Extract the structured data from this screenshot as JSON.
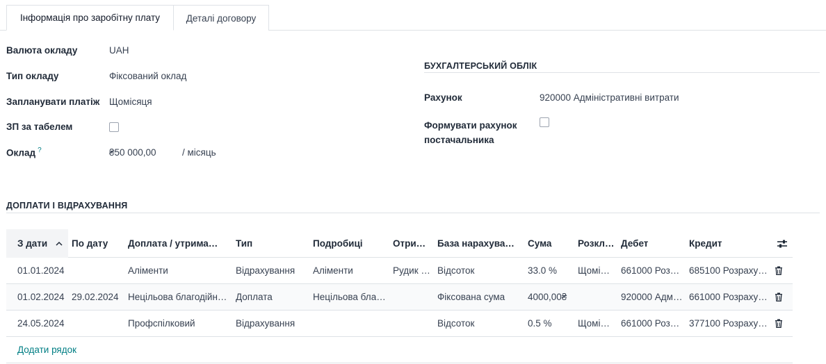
{
  "tabs": [
    {
      "label": "Інформація про заробітну плату",
      "active": true
    },
    {
      "label": "Деталі договору",
      "active": false
    }
  ],
  "salary": {
    "currency_label": "Валюта окладу",
    "currency_value": "UAH",
    "type_label": "Тип окладу",
    "type_value": "Фіксований оклад",
    "schedule_label": "Запланувати платіж",
    "schedule_value": "Щомісяця",
    "timesheet_label": "ЗП за табелем",
    "timesheet_checked": false,
    "wage_label": "Оклад",
    "wage_help": "?",
    "wage_value": "₴50 000,00",
    "wage_period": "/ місяць"
  },
  "accounting": {
    "title": "БУХГАЛТЕРСЬКИЙ ОБЛІК",
    "account_label": "Рахунок",
    "account_value": "920000 Адміністративні витрати",
    "vendor_bill_label_1": "Формувати рахунок",
    "vendor_bill_label_2": "постачальника",
    "vendor_bill_checked": false
  },
  "allowances": {
    "title": "ДОПЛАТИ І ВІДРАХУВАННЯ",
    "columns": {
      "date_from": "З дати",
      "date_to": "По дату",
      "allowance": "Доплата / утрима…",
      "type": "Тип",
      "details": "Подробиці",
      "recipient": "Отри…",
      "base": "База нарахува…",
      "amount": "Сума",
      "distribution": "Розкл…",
      "debit": "Дебет",
      "credit": "Кредит"
    },
    "rows": [
      {
        "date_from": "01.01.2024",
        "date_to": "",
        "allowance": "Аліменти",
        "type": "Відрахування",
        "details": "Аліменти",
        "recipient": "Рудик …",
        "base": "Відсоток",
        "amount": "33.0 %",
        "distribution": "Щомі…",
        "debit": "661000 Роз…",
        "credit": "685100 Розраху…"
      },
      {
        "date_from": "01.02.2024",
        "date_to": "29.02.2024",
        "allowance": "Нецільова благодійн…",
        "type": "Доплата",
        "details": "Нецільова бла…",
        "recipient": "",
        "base": "Фіксована сума",
        "amount": "4000,00₴",
        "distribution": "",
        "debit": "920000 Адм…",
        "credit": "661000 Розраху…"
      },
      {
        "date_from": "24.05.2024",
        "date_to": "",
        "allowance": "Профспілковий",
        "type": "Відрахування",
        "details": "",
        "recipient": "",
        "base": "Відсоток",
        "amount": "0.5 %",
        "distribution": "Щомі…",
        "debit": "661000 Роз…",
        "credit": "377100 Розраху…"
      }
    ],
    "add_line": "Додати рядок"
  },
  "colors": {
    "accent": "#017e84",
    "border": "#dee2e6",
    "text": "#374151"
  }
}
